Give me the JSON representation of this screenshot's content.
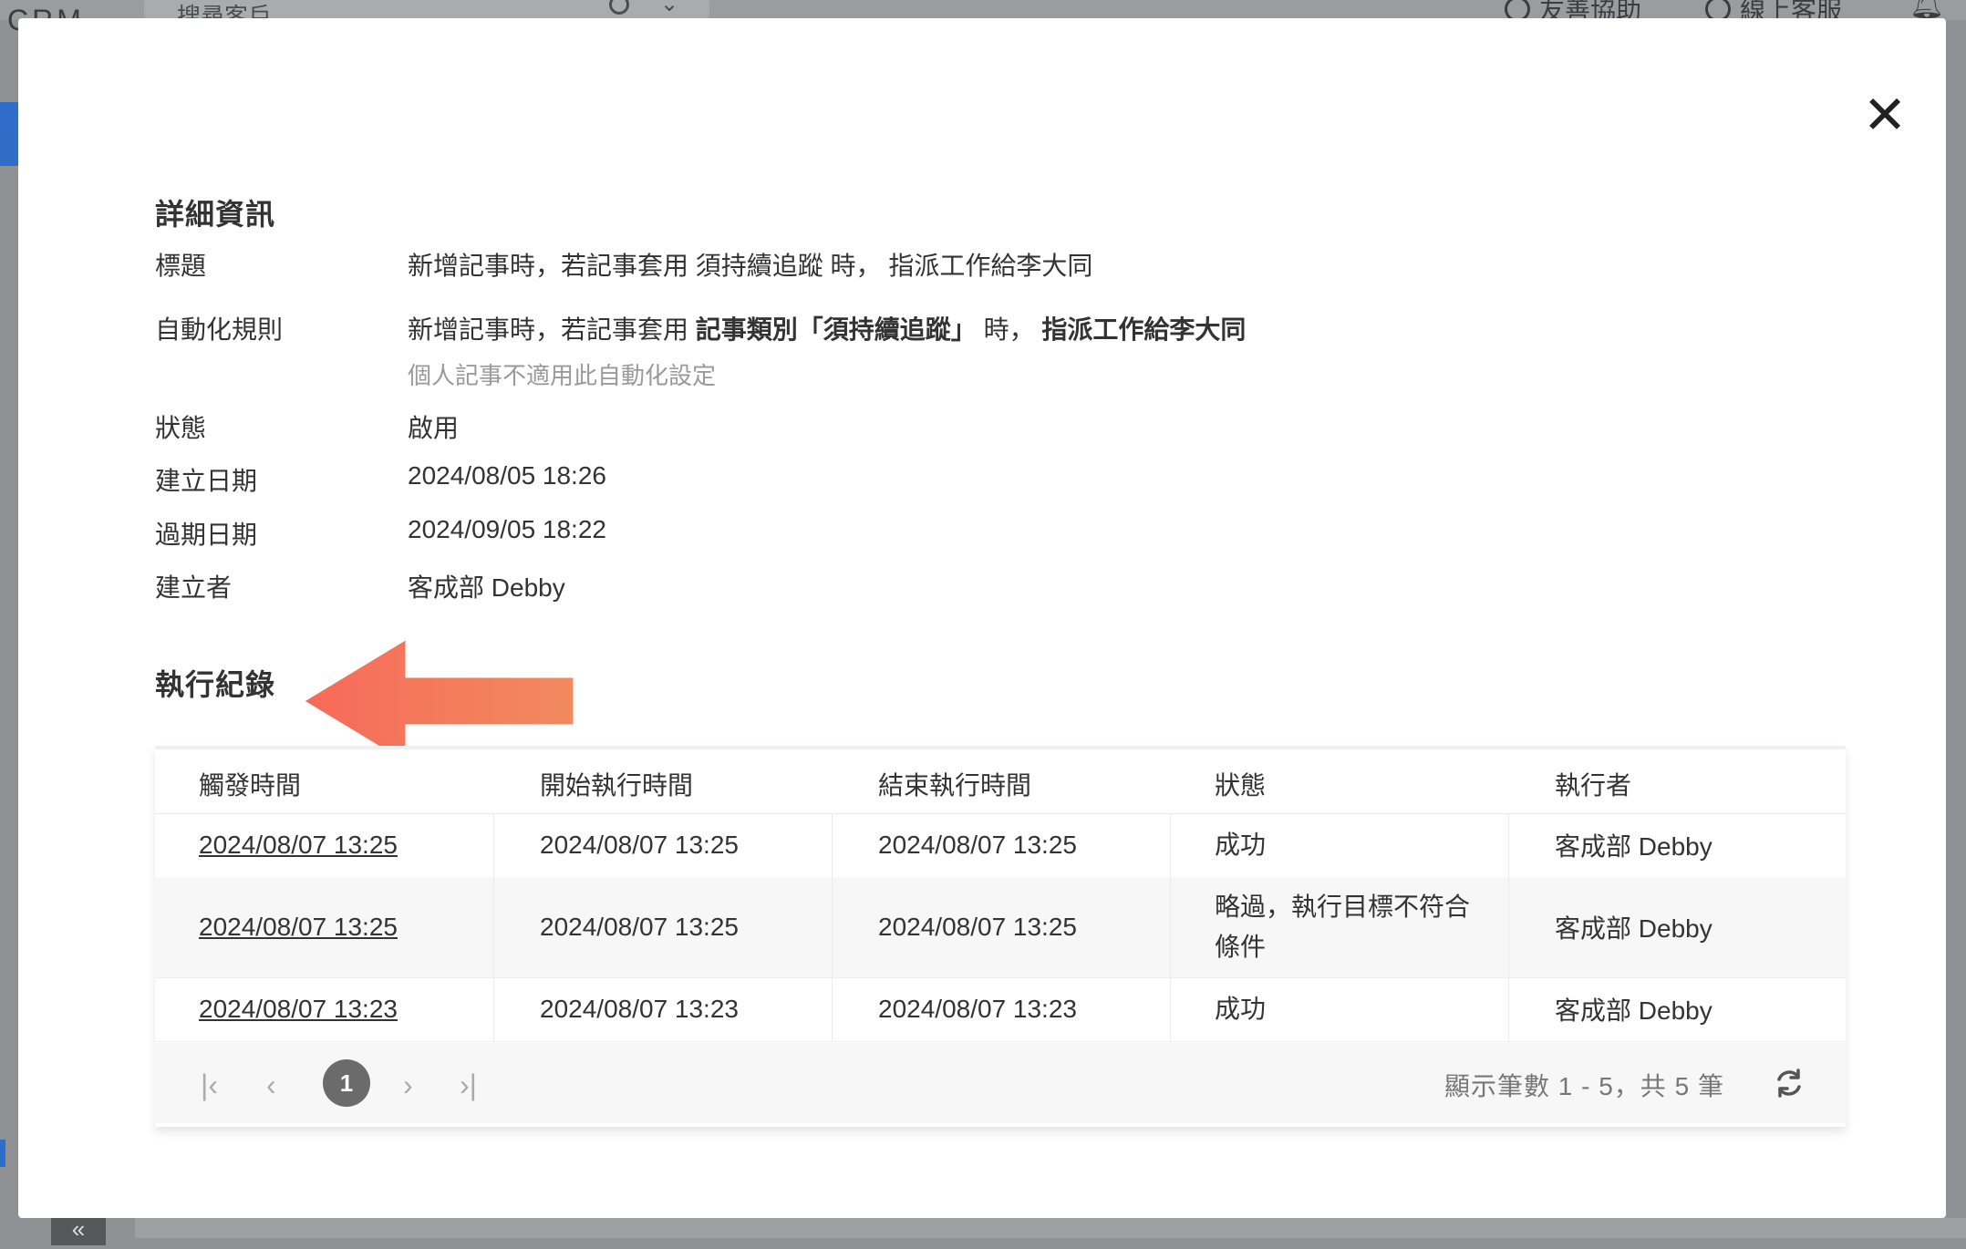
{
  "background": {
    "logo": "CRM",
    "search_placeholder": "搜尋客戶",
    "help_label": "友善協助",
    "service_label": "線上客服"
  },
  "modal": {
    "close_label": "✕",
    "details_title": "詳細資訊",
    "details": {
      "title": {
        "label": "標題",
        "value": "新增記事時，若記事套用 須持續追蹤 時， 指派工作給李大同"
      },
      "rule": {
        "label": "自動化規則",
        "part1": "新增記事時，若記事套用 ",
        "part2_bold": "記事類別「須持續追蹤」",
        "part3": " 時， ",
        "part4_bold": "指派工作給李大同",
        "note": "個人記事不適用此自動化設定"
      },
      "status": {
        "label": "狀態",
        "value": "啟用"
      },
      "created_date": {
        "label": "建立日期",
        "value": "2024/08/05 18:26"
      },
      "expiry_date": {
        "label": "過期日期",
        "value": "2024/09/05 18:22"
      },
      "creator": {
        "label": "建立者",
        "value": "客成部 Debby"
      }
    },
    "log_title": "執行紀錄",
    "log_table": {
      "columns": [
        "觸發時間",
        "開始執行時間",
        "結束執行時間",
        "狀態",
        "執行者"
      ],
      "rows": [
        {
          "trigger": "2024/08/07 13:25",
          "start": "2024/08/07 13:25",
          "end": "2024/08/07 13:25",
          "status": "成功",
          "executor": "客成部 Debby"
        },
        {
          "trigger": "2024/08/07 13:25",
          "start": "2024/08/07 13:25",
          "end": "2024/08/07 13:25",
          "status": "略過，執行目標不符合條件",
          "executor": "客成部 Debby"
        },
        {
          "trigger": "2024/08/07 13:23",
          "start": "2024/08/07 13:23",
          "end": "2024/08/07 13:23",
          "status": "成功",
          "executor": "客成部 Debby"
        }
      ]
    },
    "pagination": {
      "current_page": "1",
      "info": "顯示筆數 1 - 5，共 5 筆"
    }
  },
  "colors": {
    "annotation_arrow": "#f2735f",
    "pager_current": "#6b6b6b"
  }
}
